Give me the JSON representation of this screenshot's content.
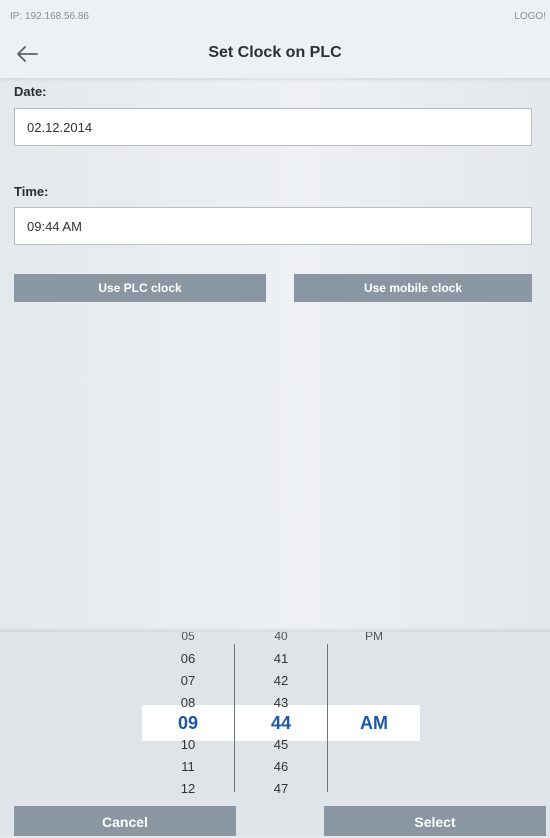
{
  "status": {
    "ip": "IP: 192.168.56.86",
    "logo": "LOGO!"
  },
  "header": {
    "title": "Set Clock on PLC",
    "back_icon": "arrow-left-icon"
  },
  "form": {
    "date_label": "Date:",
    "date_value": "02.12.2014",
    "time_label": "Time:",
    "time_value": "09:44 AM"
  },
  "buttons": {
    "plc_clock": "Use PLC clock",
    "mobile_clock": "Use mobile clock"
  },
  "picker": {
    "hours": {
      "partial_top": "05",
      "items": [
        "06",
        "07",
        "08",
        "09",
        "10",
        "11",
        "12"
      ],
      "selected": "09"
    },
    "minutes": {
      "partial_top": "40",
      "items": [
        "41",
        "42",
        "43",
        "44",
        "45",
        "46",
        "47"
      ],
      "selected": "44"
    },
    "period": {
      "partial_top": "PM",
      "selected": "AM"
    },
    "cancel_label": "Cancel",
    "select_label": "Select"
  },
  "colors": {
    "accent": "#1f57a8",
    "button": "#8a97a2",
    "background": "#e6ebee"
  }
}
